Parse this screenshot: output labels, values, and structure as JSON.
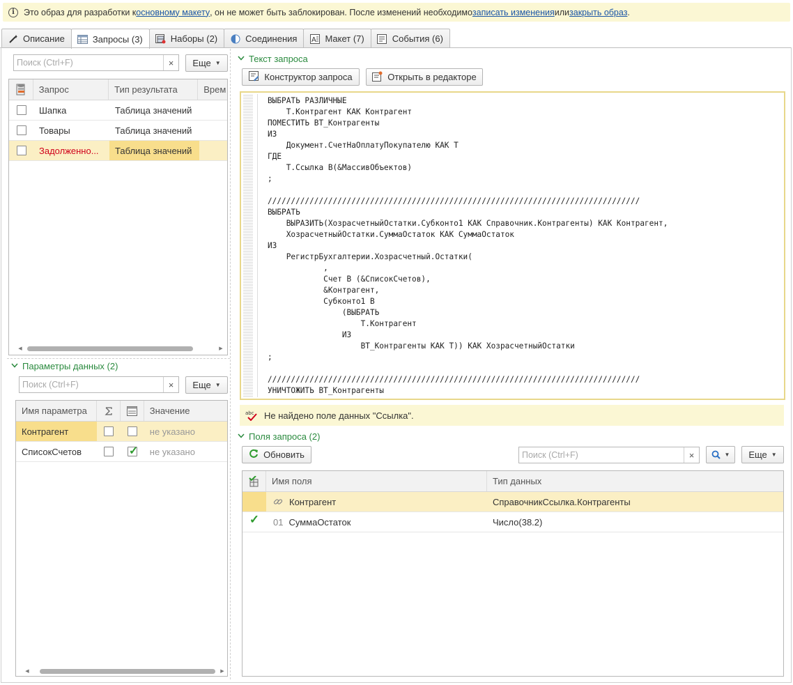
{
  "infobar": {
    "text_before": "Это образ для разработки к ",
    "link1": "основному макету",
    "text_mid": ", он не может быть заблокирован. После изменений необходимо ",
    "link2": "записать изменения",
    "text_or": " или ",
    "link3": "закрыть образ",
    "text_end": "."
  },
  "tabs": [
    {
      "label": "Описание",
      "icon": "wand-icon"
    },
    {
      "label": "Запросы (3)",
      "icon": "table-icon",
      "active": true
    },
    {
      "label": "Наборы (2)",
      "icon": "sets-icon"
    },
    {
      "label": "Соединения",
      "icon": "half-circle-icon"
    },
    {
      "label": "Макет (7)",
      "icon": "layout-icon"
    },
    {
      "label": "События (6)",
      "icon": "events-icon"
    }
  ],
  "queries_panel": {
    "search_placeholder": "Поиск (Ctrl+F)",
    "clear": "×",
    "more_label": "Еще",
    "columns": [
      "Запрос",
      "Тип результата",
      "Врем"
    ],
    "rows": [
      {
        "name": "Шапка",
        "type": "Таблица значений"
      },
      {
        "name": "Товары",
        "type": "Таблица значений"
      },
      {
        "name": "Задолженно...",
        "type": "Таблица значений"
      }
    ]
  },
  "params_panel": {
    "title": "Параметры данных (2)",
    "search_placeholder": "Поиск (Ctrl+F)",
    "clear": "×",
    "more_label": "Еще",
    "columns": [
      "Имя параметра",
      "Значение"
    ],
    "rows": [
      {
        "name": "Контрагент",
        "value": "не указано",
        "check2": false
      },
      {
        "name": "СписокСчетов",
        "value": "не указано",
        "check2": true
      }
    ]
  },
  "query_text": {
    "title": "Текст запроса",
    "constructor_label": "Конструктор запроса",
    "open_editor_label": "Открыть в редакторе",
    "code": "ВЫБРАТЬ РАЗЛИЧНЫЕ\n    Т.Контрагент КАК Контрагент\nПОМЕСТИТЬ ВТ_Контрагенты\nИЗ\n    Документ.СчетНаОплатуПокупателю КАК Т\nГДЕ\n    Т.Ссылка В(&МассивОбъектов)\n;\n\n////////////////////////////////////////////////////////////////////////////////\nВЫБРАТЬ\n    ВЫРАЗИТЬ(ХозрасчетныйОстатки.Субконто1 КАК Справочник.Контрагенты) КАК Контрагент,\n    ХозрасчетныйОстатки.СуммаОстаток КАК СуммаОстаток\nИЗ\n    РегистрБухгалтерии.Хозрасчетный.Остатки(\n            ,\n            Счет В (&СписокСчетов),\n            &Контрагент,\n            Субконто1 В\n                (ВЫБРАТЬ\n                    Т.Контрагент\n                ИЗ\n                    ВТ_Контрагенты КАК Т)) КАК ХозрасчетныйОстатки\n;\n\n////////////////////////////////////////////////////////////////////////////////\nУНИЧТОЖИТЬ ВТ_Контрагенты",
    "message": "Не найдено поле данных \"Ссылка\"."
  },
  "fields_panel": {
    "title": "Поля запроса (2)",
    "refresh_label": "Обновить",
    "search_placeholder": "Поиск (Ctrl+F)",
    "clear": "×",
    "more_label": "Еще",
    "columns": [
      "Имя поля",
      "Тип данных"
    ],
    "rows": [
      {
        "prefix": "",
        "name": "Контрагент",
        "type": "СправочникСсылка.Контрагенты"
      },
      {
        "prefix": "01",
        "name": "СуммаОстаток",
        "type": "Число(38.2)"
      }
    ]
  },
  "colors": {
    "accent_green": "#2a8a3e",
    "selection_row": "#fbefc4",
    "selection_cell": "#f8de8c",
    "info_bg": "#fbf7d4",
    "link": "#1a55a6",
    "error_text": "#d0021b"
  }
}
